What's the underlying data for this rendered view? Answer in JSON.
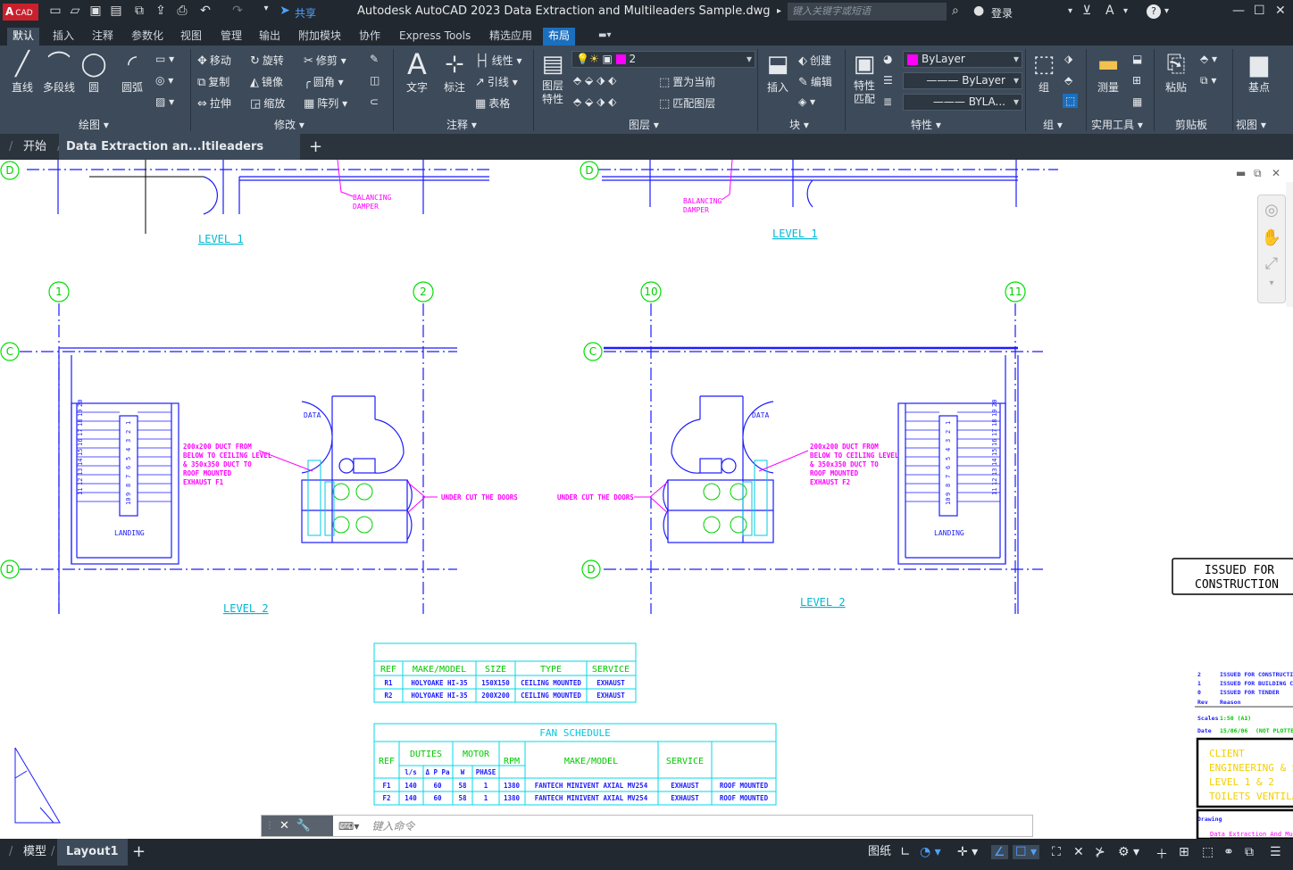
{
  "app": {
    "title": "Autodesk AutoCAD 2023    Data Extraction and Multileaders Sample.dwg",
    "logo_a": "A",
    "logo_cad": "CAD",
    "share": "共享",
    "search_placeholder": "键入关键字或短语",
    "login": "登录",
    "help": "?"
  },
  "ribbon_tabs": [
    "默认",
    "插入",
    "注释",
    "参数化",
    "视图",
    "管理",
    "输出",
    "附加模块",
    "协作",
    "Express Tools",
    "精选应用",
    "布局"
  ],
  "ribbon": {
    "draw": {
      "line": "直线",
      "polyline": "多段线",
      "circle": "圆",
      "arc": "圆弧",
      "label": "绘图"
    },
    "modify": {
      "move": "移动",
      "rotate": "旋转",
      "trim": "修剪",
      "copy": "复制",
      "mirror": "镜像",
      "fillet": "圆角",
      "stretch": "拉伸",
      "scale": "缩放",
      "array": "阵列",
      "label": "修改"
    },
    "annotation": {
      "text": "文字",
      "dimension": "标注",
      "linear": "线性",
      "leader": "引线",
      "table": "表格",
      "label": "注释"
    },
    "layers": {
      "props": "图层\n特性",
      "current_layer": "2",
      "make_current": "置为当前",
      "match_layer": "匹配图层",
      "label": "图层"
    },
    "block": {
      "insert": "插入",
      "create": "创建",
      "edit": "编辑",
      "label": "块"
    },
    "properties": {
      "match": "特性\n匹配",
      "color": "ByLayer",
      "linetype": "ByLayer",
      "lineweight": "BYLA...",
      "label": "特性"
    },
    "groups": {
      "group": "组",
      "label": "组"
    },
    "utilities": {
      "measure": "测量",
      "label": "实用工具"
    },
    "clipboard": {
      "paste": "粘贴",
      "label": "剪贴板"
    },
    "view": {
      "base": "基点",
      "label": "视图"
    }
  },
  "doc_tabs": {
    "start": "开始",
    "active": "Data Extraction an...ltileaders Sample*",
    "add": "+"
  },
  "drawing": {
    "level1_left": "LEVEL 1",
    "level1_right": "LEVEL 1",
    "level2_left": "LEVEL 2",
    "level2_right": "LEVEL 2",
    "balancing_damper_1": "BALANCING",
    "balancing_damper_2": "DAMPER",
    "grid_c": "C",
    "grid_d": "D",
    "grid_1": "1",
    "grid_2": "2",
    "grid_10": "10",
    "grid_11": "11",
    "data": "DATA",
    "landing": "LANDING",
    "duct_note_f1": [
      "200x200 DUCT FROM",
      "BELOW TO CEILING LEVEL",
      "& 350x350 DUCT TO",
      "ROOF MOUNTED",
      "EXHAUST F1"
    ],
    "duct_note_f2": [
      "200x200 DUCT FROM",
      "BELOW TO CEILING LEVEL",
      "& 350x350 DUCT TO",
      "ROOF MOUNTED",
      "EXHAUST F2"
    ],
    "under_cut": "UNDER CUT THE DOORS",
    "issued_1": "ISSUED FOR",
    "issued_2": "CONSTRUCTION",
    "stair_left_a": [
      "20",
      "19",
      "18",
      "17",
      "16",
      "15",
      "14",
      "13",
      "12",
      "11"
    ],
    "stair_left_b": [
      "1",
      "2",
      "3",
      "4",
      "5",
      "6",
      "7",
      "8",
      "9",
      "10"
    ]
  },
  "grille_table": {
    "headers": [
      "REF",
      "MAKE/MODEL",
      "SIZE",
      "TYPE",
      "SERVICE"
    ],
    "rows": [
      [
        "R1",
        "HOLYOAKE HI-35",
        "150X150",
        "CEILING MOUNTED",
        "EXHAUST"
      ],
      [
        "R2",
        "HOLYOAKE HI-35",
        "200X200",
        "CEILING MOUNTED",
        "EXHAUST"
      ]
    ]
  },
  "fan_schedule": {
    "title": "FAN SCHEDULE",
    "h_ref": "REF",
    "h_duties": "DUTIES",
    "h_motor": "MOTOR",
    "h_rpm": "RPM",
    "h_make": "MAKE/MODEL",
    "h_service": "SERVICE",
    "h_ls": "l/s",
    "h_pa": "Δ P Pa",
    "h_w": "W",
    "h_phase": "PHASE",
    "rows": [
      [
        "F1",
        "140",
        "60",
        "58",
        "1",
        "1380",
        "FANTECH MINIVENT AXIAL MV254",
        "EXHAUST",
        "ROOF MOUNTED"
      ],
      [
        "F2",
        "140",
        "60",
        "58",
        "1",
        "1380",
        "FANTECH MINIVENT AXIAL MV254",
        "EXHAUST",
        "ROOF MOUNTED"
      ]
    ]
  },
  "title_block": {
    "rev_rows": [
      [
        "2",
        "ISSUED FOR CONSTRUCTION"
      ],
      [
        "1",
        "ISSUED FOR BUILDING CONS"
      ],
      [
        "0",
        "ISSUED FOR TENDER"
      ],
      [
        "Rev",
        "Reason"
      ]
    ],
    "scales_label": "Scales",
    "scales_val": "1:50 (A1)",
    "date_label": "Date",
    "date_val": "15/06/06",
    "plotted": "(NOT PLOTTED",
    "client": [
      "CLIENT",
      "ENGINEERING & SCI",
      "LEVEL 1 & 2",
      "TOILETS VENTILAT"
    ],
    "drawing_label": "Drawing",
    "drawing_name": "Data Extraction And Multileade"
  },
  "command": {
    "placeholder": "键入命令"
  },
  "status": {
    "model": "模型",
    "layout1": "Layout1",
    "add": "+",
    "paper": "图纸"
  }
}
